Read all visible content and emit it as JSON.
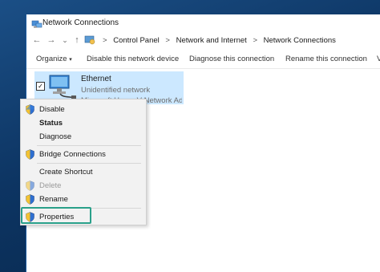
{
  "window": {
    "title": "Network Connections"
  },
  "address": {
    "crumbs": [
      "Control Panel",
      "Network and Internet",
      "Network Connections"
    ],
    "separator": ">"
  },
  "commandbar": {
    "organize": "Organize",
    "organize_arrow": "▾",
    "disable": "Disable this network device",
    "diagnose": "Diagnose this connection",
    "rename": "Rename this connection",
    "overflow": "V"
  },
  "connection": {
    "name": "Ethernet",
    "status": "Unidentified network",
    "device": "Microsoft Hyper-V Network Adapter",
    "checked_glyph": "✓"
  },
  "context_menu": {
    "items": [
      {
        "label": "Disable",
        "shield": true,
        "bold": false,
        "disabled": false
      },
      {
        "label": "Status",
        "shield": false,
        "bold": true,
        "disabled": false
      },
      {
        "label": "Diagnose",
        "shield": false,
        "bold": false,
        "disabled": false
      },
      {
        "label": "Bridge Connections",
        "shield": true,
        "bold": false,
        "disabled": false
      },
      {
        "label": "Create Shortcut",
        "shield": false,
        "bold": false,
        "disabled": false
      },
      {
        "label": "Delete",
        "shield": true,
        "bold": false,
        "disabled": true
      },
      {
        "label": "Rename",
        "shield": true,
        "bold": false,
        "disabled": false
      },
      {
        "label": "Properties",
        "shield": true,
        "bold": false,
        "disabled": false
      }
    ]
  },
  "colors": {
    "selection": "#cce8ff",
    "highlight_box": "#2aa08a",
    "desktop": "#0d3563"
  }
}
